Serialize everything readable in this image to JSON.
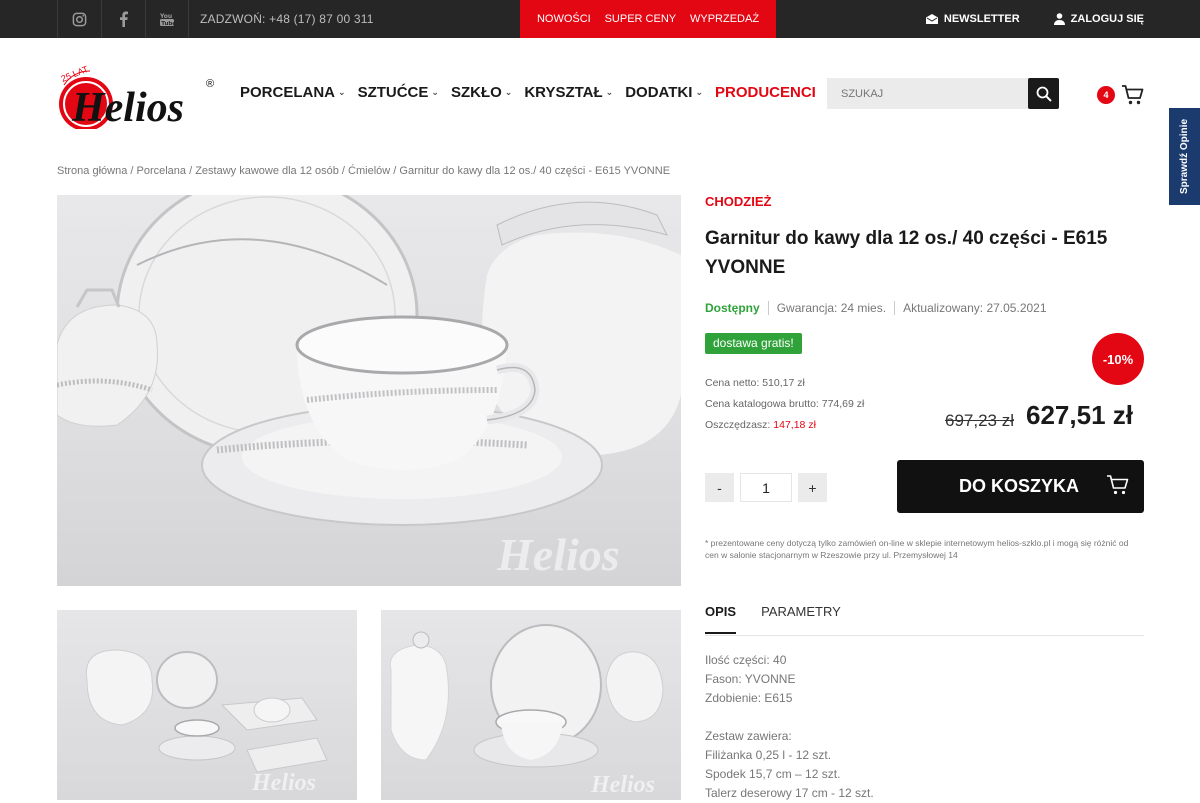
{
  "topbar": {
    "social": [
      "instagram-icon",
      "facebook-icon",
      "youtube-icon"
    ],
    "phone": "ZADZWOŃ: +48 (17) 87 00 311",
    "promo": [
      "NOWOŚCI",
      "SUPER CENY",
      "WYPRZEDAŻ"
    ],
    "newsletter": "NEWSLETTER",
    "login": "ZALOGUJ SIĘ",
    "promo_color": "#e30613"
  },
  "header": {
    "logo_text": "Helios",
    "logo_badge": "25 LAT",
    "logo_reg": "®",
    "nav": [
      {
        "label": "PORCELANA",
        "chevron": true
      },
      {
        "label": "SZTUĆCE",
        "chevron": true
      },
      {
        "label": "SZKŁO",
        "chevron": true
      },
      {
        "label": "KRYSZTAŁ",
        "chevron": true
      },
      {
        "label": "DODATKI",
        "chevron": true
      },
      {
        "label": "PRODUCENCI",
        "chevron": false
      }
    ],
    "search_placeholder": "SZUKAJ",
    "cart_count": "4",
    "side_tab": "Sprawdź Opinie"
  },
  "breadcrumb": "Strona główna / Porcelana / Zestawy kawowe dla 12 osób / Ćmielów / Garnitur do kawy dla 12 os./ 40 części - E615 YVONNE",
  "product": {
    "brand": "CHODZIEŻ",
    "title": "Garnitur do kawy dla 12 os./ 40 części - E615 YVONNE",
    "availability": "Dostępny",
    "warranty": "Gwarancja: 24 mies.",
    "updated": "Aktualizowany: 27.05.2021",
    "free_shipping": "dostawa gratis!",
    "discount": "-10%",
    "net_price_label": "Cena netto: 510,17 zł",
    "catalog_price_label": "Cena katalogowa brutto: 774,69 zł",
    "savings_label": "Oszczędzasz:",
    "savings_value": "147,18 zł",
    "old_price": "697,23 zł",
    "price": "627,51 zł",
    "qty_minus": "-",
    "qty_value": "1",
    "qty_plus": "+",
    "add_to_cart": "DO KOSZYKA",
    "note": "* prezentowane ceny dotyczą tylko zamówień on-line w sklepie internetowym helios-szklo.pl i mogą się różnić od cen w salonie stacjonarnym w Rzeszowie przy ul. Przemysłowej 14",
    "watermark": "Helios"
  },
  "tabs": [
    "OPIS",
    "PARAMETRY"
  ],
  "description": [
    "Ilość części: 40",
    "Fason: YVONNE",
    "Zdobienie: E615",
    "",
    "Zestaw zawiera:",
    "Filiżanka 0,25 l - 12 szt.",
    "Spodek 15,7 cm – 12 szt.",
    "Talerz deserowy 17 cm - 12 szt."
  ]
}
